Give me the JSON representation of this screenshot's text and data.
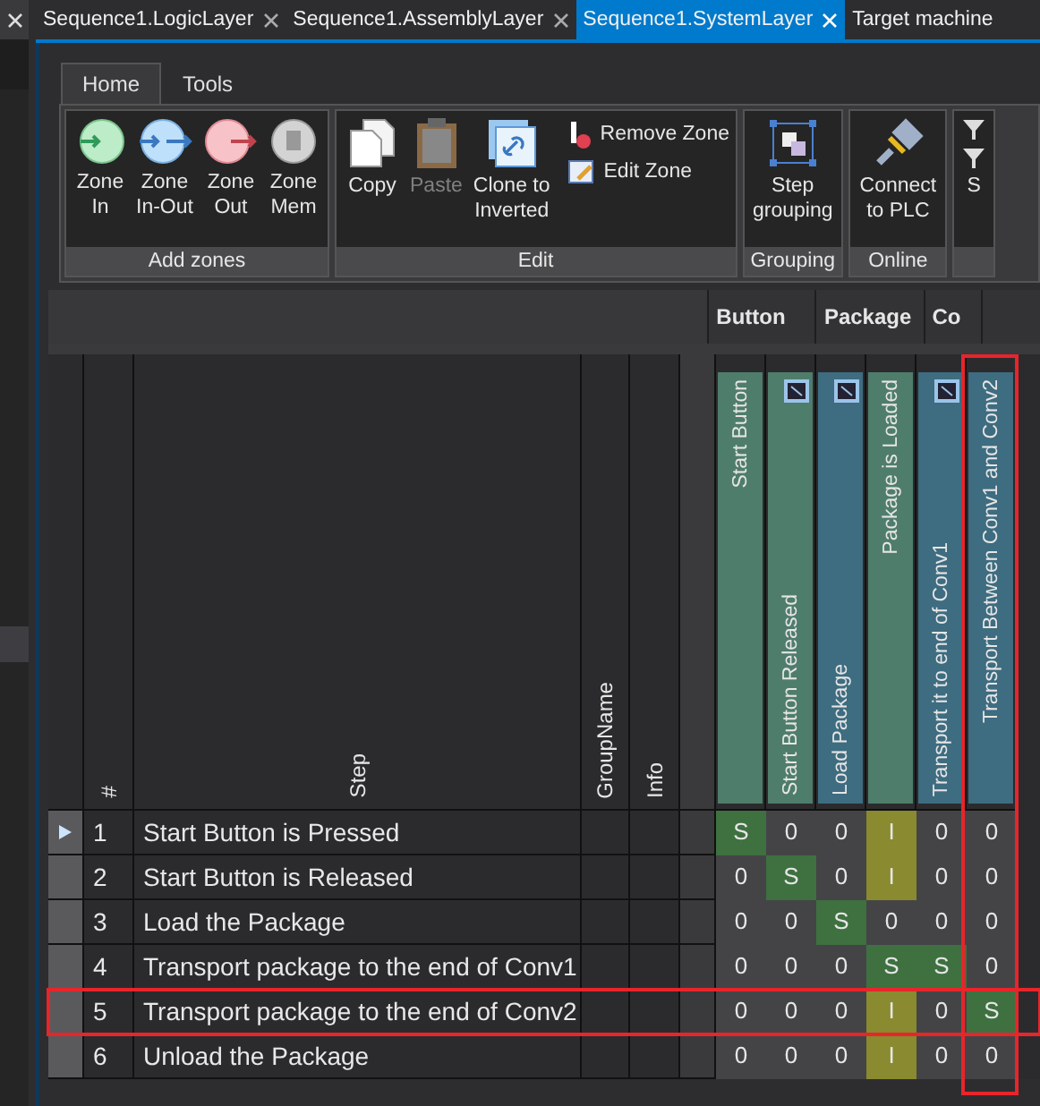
{
  "doc_tabs": [
    {
      "label": "Sequence1.LogicLayer",
      "selected": false,
      "closable": true
    },
    {
      "label": "Sequence1.AssemblyLayer",
      "selected": false,
      "closable": true
    },
    {
      "label": "Sequence1.SystemLayer",
      "selected": true,
      "closable": true
    },
    {
      "label": "Target machine",
      "selected": false,
      "closable": false
    }
  ],
  "ribbon": {
    "tabs": [
      {
        "label": "Home",
        "selected": true
      },
      {
        "label": "Tools",
        "selected": false
      }
    ],
    "groups": [
      {
        "label": "Add zones",
        "buttons": [
          {
            "kind": "zone-in",
            "label": "Zone\nIn",
            "disabled": false
          },
          {
            "kind": "zone-inout",
            "label": "Zone\nIn-Out",
            "disabled": false
          },
          {
            "kind": "zone-out",
            "label": "Zone\nOut",
            "disabled": false
          },
          {
            "kind": "zone-mem",
            "label": "Zone\nMem",
            "disabled": false
          }
        ]
      },
      {
        "label": "Edit",
        "buttons": [
          {
            "kind": "copy",
            "label": "Copy",
            "disabled": false
          },
          {
            "kind": "paste",
            "label": "Paste",
            "disabled": true
          },
          {
            "kind": "clone",
            "label": "Clone to\nInverted",
            "disabled": false
          }
        ],
        "small_buttons": [
          {
            "kind": "remove-zone",
            "label": "Remove Zone"
          },
          {
            "kind": "edit-zone",
            "label": "Edit Zone"
          }
        ]
      },
      {
        "label": "Grouping",
        "buttons": [
          {
            "kind": "step-grouping",
            "label": "Step\ngrouping",
            "disabled": false
          }
        ]
      },
      {
        "label": "Online",
        "buttons": [
          {
            "kind": "connect",
            "label": "Connect\nto PLC",
            "disabled": false
          }
        ]
      },
      {
        "buttons": [
          {
            "kind": "filter",
            "label": "S",
            "disabled": false
          }
        ]
      }
    ]
  },
  "grid": {
    "columns": [
      "#",
      "Step",
      "GroupName",
      "Info"
    ],
    "signal_groups": [
      {
        "label": "Button",
        "signals": [
          {
            "label": "Start Button",
            "color": "#4f7d6b",
            "has_icon": false,
            "highlighted": false
          },
          {
            "label": "Start Button Released",
            "color": "#4f7d6b",
            "has_icon": true,
            "highlighted": false
          }
        ]
      },
      {
        "label": "Package",
        "signals": [
          {
            "label": "Load Package",
            "color": "#3e6c80",
            "has_icon": true,
            "highlighted": false
          },
          {
            "label": "Package is Loaded",
            "color": "#4f7d6b",
            "has_icon": false,
            "highlighted": false
          }
        ]
      },
      {
        "label": "Co",
        "signals": [
          {
            "label": "Transport it to end of Conv1",
            "color": "#3e6c80",
            "has_icon": true,
            "highlighted": false
          }
        ]
      },
      {
        "signals": [
          {
            "label": "Transport Between Conv1 and Conv2",
            "color": "#3e6c80",
            "has_icon": false,
            "highlighted": true
          }
        ]
      }
    ],
    "rows": [
      {
        "number": "1",
        "step": "Start Button is Pressed",
        "selected": true,
        "highlighted": false,
        "cells": [
          "S",
          "0",
          "0",
          "I",
          "0",
          "0"
        ]
      },
      {
        "number": "2",
        "step": "Start Button is Released",
        "selected": false,
        "highlighted": false,
        "cells": [
          "0",
          "S",
          "0",
          "I",
          "0",
          "0"
        ]
      },
      {
        "number": "3",
        "step": "Load the Package",
        "selected": false,
        "highlighted": false,
        "cells": [
          "0",
          "0",
          "S",
          "0",
          "0",
          "0"
        ]
      },
      {
        "number": "4",
        "step": "Transport package to the end of Conv1",
        "selected": false,
        "highlighted": false,
        "cells": [
          "0",
          "0",
          "0",
          "S",
          "S",
          "0"
        ]
      },
      {
        "number": "5",
        "step": "Transport package to the end of Conv2",
        "selected": false,
        "highlighted": true,
        "cells": [
          "0",
          "0",
          "0",
          "I",
          "0",
          "S"
        ]
      },
      {
        "number": "6",
        "step": "Unload the Package",
        "selected": false,
        "highlighted": false,
        "cells": [
          "0",
          "0",
          "0",
          "I",
          "0",
          "0"
        ]
      }
    ]
  }
}
